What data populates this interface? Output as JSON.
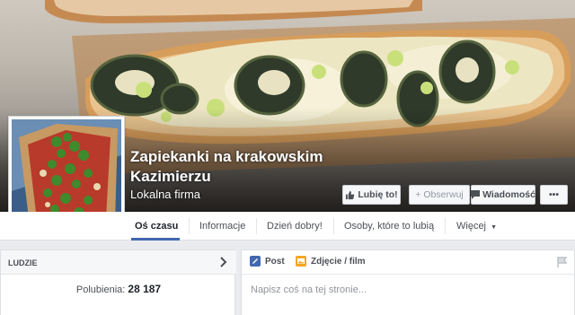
{
  "cover": {
    "description_icon": "cover-photo"
  },
  "profile": {
    "name": "Zapiekanki na krakowskim Kazimierzu",
    "category": "Lokalna firma"
  },
  "actions": {
    "like": "Lubię to!",
    "follow": "Obserwuj",
    "message": "Wiadomość",
    "more": "•••"
  },
  "tabs": [
    {
      "label": "Oś czasu",
      "active": true
    },
    {
      "label": "Informacje"
    },
    {
      "label": "Dzień dobry!"
    },
    {
      "label": "Osoby, które to lubią"
    },
    {
      "label": "Więcej"
    }
  ],
  "people": {
    "title": "LUDZIE",
    "likes_label": "Polubienia:",
    "likes_count": "28 187"
  },
  "composer": {
    "post_tab": "Post",
    "photo_tab": "Zdjęcie / film",
    "placeholder": "Napisz coś na tej stronie..."
  },
  "colors": {
    "accent": "#4267b2",
    "page_bg": "#e9ebee"
  }
}
